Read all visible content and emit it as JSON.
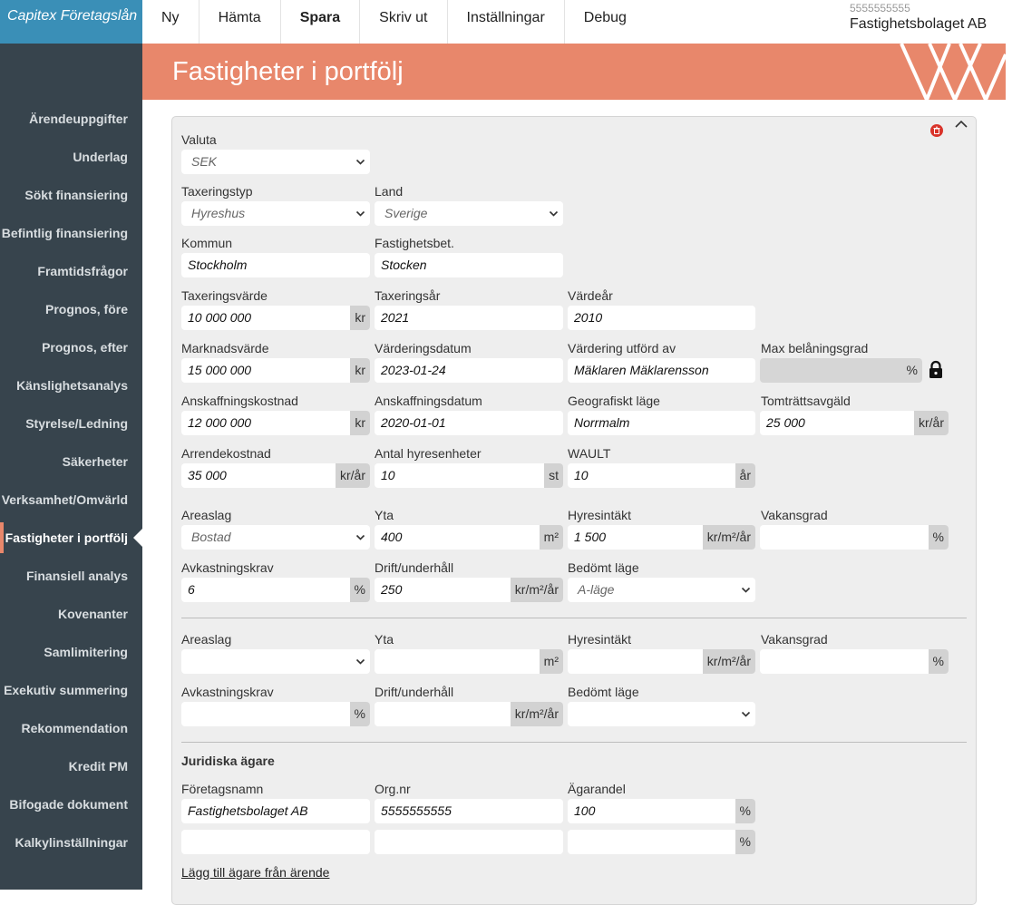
{
  "app": {
    "title": "Capitex Företagslån"
  },
  "topmenu": [
    "Ny",
    "Hämta",
    "Spara",
    "Skriv ut",
    "Inställningar",
    "Debug"
  ],
  "account": {
    "number": "5555555555",
    "name": "Fastighetsbolaget AB"
  },
  "sidebar": [
    "Ärendeuppgifter",
    "Underlag",
    "Sökt finansiering",
    "Befintlig finansiering",
    "Framtidsfrågor",
    "Prognos, före",
    "Prognos, efter",
    "Känslighetsanalys",
    "Styrelse/Ledning",
    "Säkerheter",
    "Verksamhet/Omvärld",
    "Fastigheter i portfölj",
    "Finansiell analys",
    "Kovenanter",
    "Samlimitering",
    "Exekutiv summering",
    "Rekommendation",
    "Kredit PM",
    "Bifogade dokument",
    "Kalkylinställningar"
  ],
  "page": {
    "title": "Fastigheter i portfölj"
  },
  "labels": {
    "valuta": "Valuta",
    "taxeringstyp": "Taxeringstyp",
    "land": "Land",
    "kommun": "Kommun",
    "fastighetsbet": "Fastighetsbet.",
    "taxeringsvarde": "Taxeringsvärde",
    "taxeringsar": "Taxeringsår",
    "vardear": "Värdeår",
    "marknadsvarde": "Marknadsvärde",
    "varderingsdatum": "Värderingsdatum",
    "vardering_utford": "Värdering utförd av",
    "max_belaningsgrad": "Max belåningsgrad",
    "anskaffningskostnad": "Anskaffningskostnad",
    "anskaffningsdatum": "Anskaffningsdatum",
    "geografiskt_lage": "Geografiskt läge",
    "tomtrattsavgald": "Tomträttsavgäld",
    "arrendekostnad": "Arrendekostnad",
    "antal_hyresenheter": "Antal hyresenheter",
    "wault": "WAULT",
    "areaslag": "Areaslag",
    "yta": "Yta",
    "hyresintakt": "Hyresintäkt",
    "vakansgrad": "Vakansgrad",
    "avkastningskrav": "Avkastningskrav",
    "drift": "Drift/underhåll",
    "bedomt_lage": "Bedömt läge",
    "juridiska_agare": "Juridiska ägare",
    "foretagsnamn": "Företagsnamn",
    "orgnr": "Org.nr",
    "agarandel": "Ägarandel"
  },
  "units": {
    "kr": "kr",
    "kr_ar": "kr/år",
    "st": "st",
    "ar": "år",
    "m2": "m²",
    "kr_m2_ar": "kr/m²/år",
    "pct": "%"
  },
  "values": {
    "valuta": "SEK",
    "taxeringstyp": "Hyreshus",
    "land": "Sverige",
    "kommun": "Stockholm",
    "fastighetsbet": "Stocken",
    "taxeringsvarde": "10 000 000",
    "taxeringsar": "2021",
    "vardear": "2010",
    "marknadsvarde": "15 000 000",
    "varderingsdatum": "2023-01-24",
    "vardering_utford": "Mäklaren Mäklarensson",
    "max_belaningsgrad": "",
    "anskaffningskostnad": "12 000 000",
    "anskaffningsdatum": "2020-01-01",
    "geografiskt_lage": "Norrmalm",
    "tomtrattsavgald": "25 000",
    "arrendekostnad": "35 000",
    "antal_hyresenheter": "10",
    "wault": "10"
  },
  "areas": [
    {
      "areaslag": "Bostad",
      "yta": "400",
      "hyresintakt": "1 500",
      "vakansgrad": "",
      "avkastningskrav": "6",
      "drift": "250",
      "bedomt_lage": "A-läge"
    },
    {
      "areaslag": "",
      "yta": "",
      "hyresintakt": "",
      "vakansgrad": "",
      "avkastningskrav": "",
      "drift": "",
      "bedomt_lage": ""
    }
  ],
  "owners": [
    {
      "foretagsnamn": "Fastighetsbolaget AB",
      "orgnr": "5555555555",
      "agarandel": "100"
    },
    {
      "foretagsnamn": "",
      "orgnr": "",
      "agarandel": ""
    }
  ],
  "add_owner_link": "Lägg till ägare från ärende",
  "colors": {
    "accent": "#e8876b",
    "sidebar": "#37444d",
    "brand": "#3a8fb7",
    "delete": "#d9332a"
  }
}
